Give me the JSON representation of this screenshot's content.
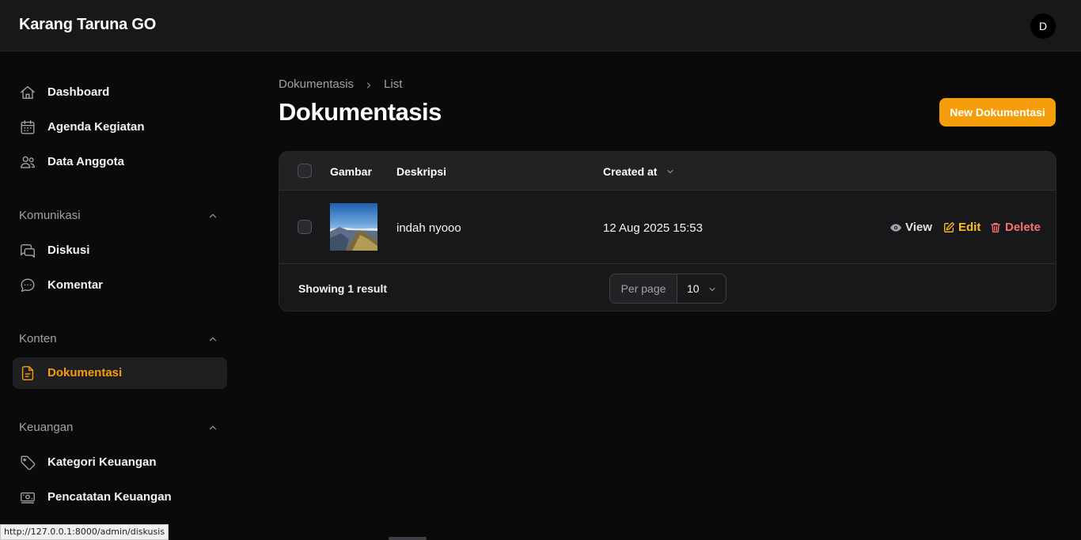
{
  "app": {
    "brand": "Karang Taruna GO",
    "avatar_initial": "D"
  },
  "sidebar": {
    "top_items": [
      {
        "label": "Dashboard",
        "icon": "home-icon"
      },
      {
        "label": "Agenda Kegiatan",
        "icon": "calendar-icon"
      },
      {
        "label": "Data Anggota",
        "icon": "users-icon"
      }
    ],
    "groups": [
      {
        "label": "Komunikasi",
        "items": [
          {
            "label": "Diskusi",
            "icon": "chat-bubbles-icon"
          },
          {
            "label": "Komentar",
            "icon": "chat-dots-icon"
          }
        ]
      },
      {
        "label": "Konten",
        "items": [
          {
            "label": "Dokumentasi",
            "icon": "document-icon",
            "active": true
          }
        ]
      },
      {
        "label": "Keuangan",
        "items": [
          {
            "label": "Kategori Keuangan",
            "icon": "tag-icon"
          },
          {
            "label": "Pencatatan Keuangan",
            "icon": "banknote-icon"
          }
        ]
      }
    ]
  },
  "breadcrumb": {
    "parent": "Dokumentasis",
    "current": "List"
  },
  "page": {
    "title": "Dokumentasis",
    "new_button": "New Dokumentasi"
  },
  "table": {
    "columns": [
      "Gambar",
      "Deskripsi",
      "Created at"
    ],
    "rows": [
      {
        "deskripsi": "indah nyooo",
        "created_at": "12 Aug 2025 15:53"
      }
    ],
    "actions": {
      "view": "View",
      "edit": "Edit",
      "delete": "Delete"
    },
    "footer": {
      "result_text": "Showing 1 result",
      "per_page_label": "Per page",
      "per_page_value": "10"
    }
  },
  "status_bar": {
    "url": "http://127.0.0.1:8000/admin/diskusis"
  },
  "colors": {
    "accent": "#f59e0b",
    "danger": "#f87171",
    "background": "#0a0a0b"
  }
}
